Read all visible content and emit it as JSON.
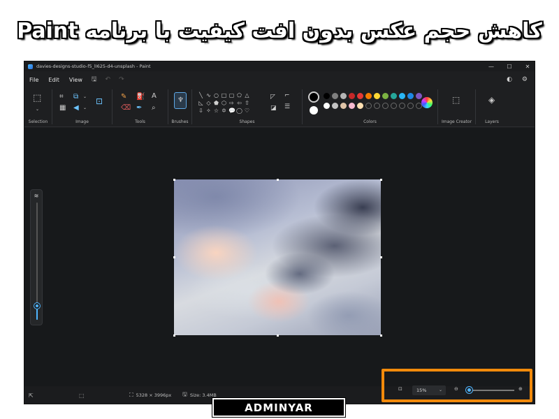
{
  "banner": {
    "title": "کاهش حجم عکس بدون افت کیفیت با برنامه Paint"
  },
  "window": {
    "title": "davies-designs-studio-f5_lI625-d4-unsplash - Paint",
    "controls": {
      "minimize": "—",
      "maximize": "☐",
      "close": "✕"
    }
  },
  "menu": {
    "items": [
      "File",
      "Edit",
      "View"
    ],
    "save_icon": "save-icon",
    "undo_icon": "undo-icon",
    "redo_icon": "redo-icon"
  },
  "ribbon": {
    "groups": {
      "selection": "Selection",
      "image": "Image",
      "tools": "Tools",
      "brushes": "Brushes",
      "shapes": "Shapes",
      "colors": "Colors",
      "image_creator": "Image Creator",
      "layers": "Layers"
    },
    "primary_color": "#000000",
    "secondary_color": "#ffffff",
    "palette": [
      "#000000",
      "#7f7f7f",
      "#b5b5b5",
      "#c62828",
      "#e53935",
      "#f57c00",
      "#fdd835",
      "#7cb342",
      "#26a69a",
      "#29b6f6",
      "#1e88e5",
      "#7e57c2"
    ],
    "palette_row2": [
      "#ffffff",
      "#c3c3c3",
      "#e0c4a8",
      "#f8bbd0",
      "#ffe0b2"
    ]
  },
  "canvas": {
    "background": "#17191b"
  },
  "status": {
    "dimensions": "5328 × 3996px",
    "size": "Size: 3.4MB",
    "zoom": "15%",
    "zoom_level": 0.05,
    "vertical_zoom_level": 0.12
  },
  "watermark": "ADMINYAR",
  "highlight_color": "#f28a0b"
}
